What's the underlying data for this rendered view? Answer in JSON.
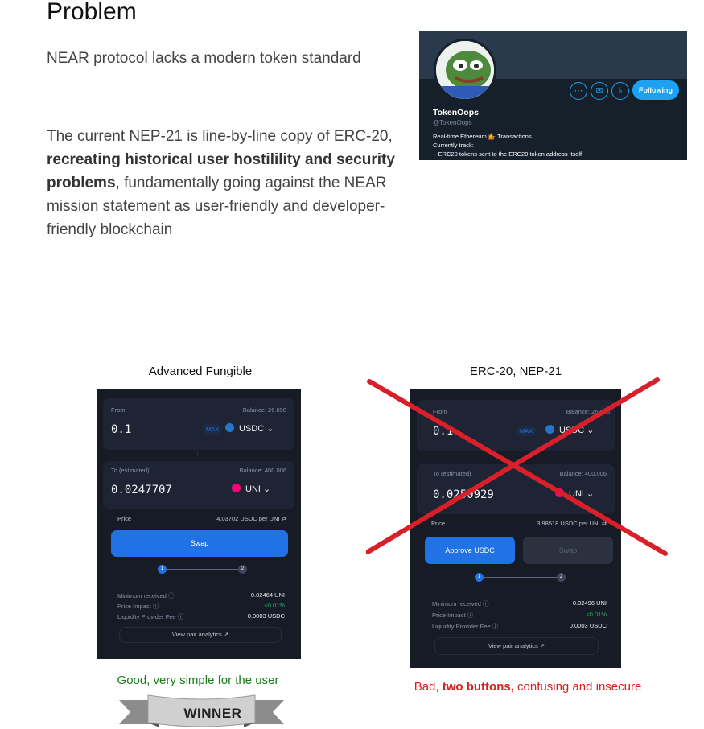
{
  "title": "Problem",
  "subtitle": "NEAR protocol lacks a modern token standard",
  "paragraph": {
    "part1": "The current NEP-21 is line-by-line copy of ERC-20, ",
    "bold": "recreating historical user hostilility and security problems",
    "part2": ", fundamentally going against the NEAR mission statement as user-friendly and developer-friendly blockchain"
  },
  "twitter": {
    "name": "TokenOops",
    "handle": "@TokenOops",
    "follow_label": "Following",
    "bio_line1": "Real-time Ethereum 💁 Transactions",
    "bio_line2": "Currently track:",
    "bio_line3": " - ERC20 tokens sent to the ERC20 token address itself",
    "more_icon": "more-icon",
    "mail_icon": "mail-icon",
    "bell_icon": "bell-icon"
  },
  "left": {
    "label": "Advanced Fungible",
    "from_label": "From",
    "from_balance": "Balance: 26.098",
    "from_amount": "0.1",
    "max_label": "MAX",
    "from_token": "USDC",
    "to_label": "To (estimated)",
    "to_balance": "Balance: 400.006",
    "to_amount": "0.0247707",
    "to_token": "UNI",
    "price_label": "Price",
    "price_value": "4.03702 USDC per UNI",
    "swap_label": "Swap",
    "step1": "1",
    "step2": "2",
    "min_received_label": "Minimum received",
    "min_received_value": "0.02464 UNI",
    "price_impact_label": "Price Impact",
    "price_impact_value": "<0.01%",
    "lp_fee_label": "Liquidity Provider Fee",
    "lp_fee_value": "0.0003 USDC",
    "analytics_label": "View pair analytics ↗",
    "caption": "Good, very simple for the user",
    "ribbon": "WINNER"
  },
  "right": {
    "label": "ERC-20, NEP-21",
    "from_label": "From",
    "from_balance": "Balance: 26.098",
    "from_amount": "0.1",
    "max_label": "MAX",
    "from_token": "USDC",
    "to_label": "To (estimated)",
    "to_balance": "Balance: 400.006",
    "to_amount": "0.0250929",
    "to_token": "UNI",
    "price_label": "Price",
    "price_value": "3.98518 USDC per UNI",
    "approve_label": "Approve USDC",
    "swap_label": "Swap",
    "step1": "1",
    "step2": "2",
    "min_received_label": "Minimum received",
    "min_received_value": "0.02496 UNI",
    "price_impact_label": "Price Impact",
    "price_impact_value": "<0.01%",
    "lp_fee_label": "Liquidity Provider Fee",
    "lp_fee_value": "0.0003 USDC",
    "analytics_label": "View pair analytics ↗",
    "caption_part1": "Bad, ",
    "caption_bold": "two buttons,",
    "caption_part2": " confusing and insecure"
  },
  "colors": {
    "accent_blue": "#2172e5",
    "cross_red": "#d9202a",
    "good_green": "#1a7d1a",
    "bad_red": "#d42020",
    "usdc_blue": "#2775ca",
    "uni_pink": "#ff007a"
  }
}
